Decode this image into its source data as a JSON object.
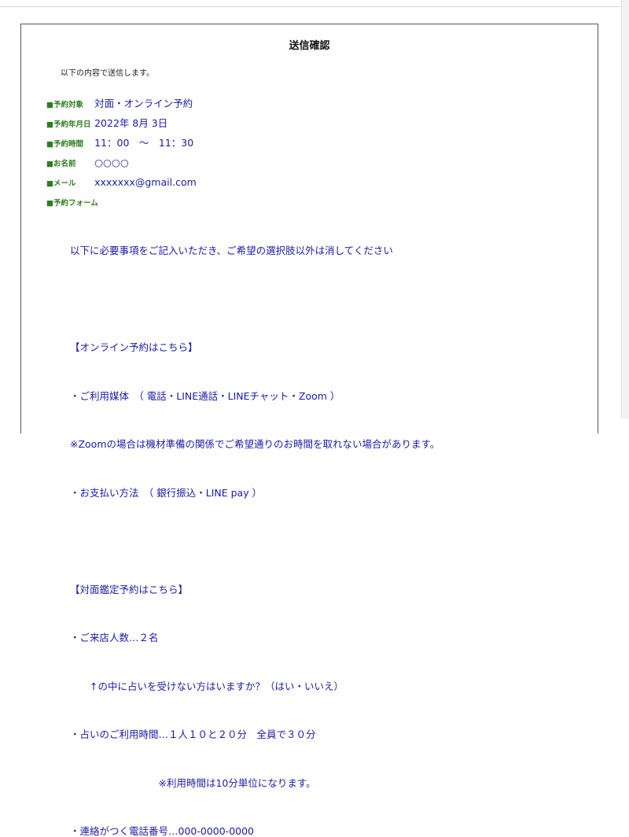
{
  "page": {
    "title": "送信確認",
    "intro": "以下の内容で送信します。"
  },
  "fields": [
    {
      "label": "■予約対象",
      "value": "対面・オンライン予約"
    },
    {
      "label": "■予約年月日",
      "value": "2022年 8月 3日"
    },
    {
      "label": "■予約時間",
      "value": "11：00　～　11：30"
    },
    {
      "label": "■お名前",
      "value": "○○○○"
    },
    {
      "label": "■メール",
      "value": "xxxxxxx@gmail.com"
    },
    {
      "label": "■予約フォーム",
      "value": ""
    }
  ],
  "form_body": [
    "以下に必要事項をご記入いただき、ご希望の選択肢以外は消してください",
    "",
    "【オンライン予約はこちら】",
    "・ご利用媒体　（ 電話・LINE通話・LINEチャット・Zoom ）",
    "※Zoomの場合は機材準備の関係でご希望通りのお時間を取れない場合があります。",
    "・お支払い方法　（ 銀行振込・LINE pay ）",
    "",
    "【対面鑑定予約はこちら】",
    "・ご来店人数…２名",
    "　　↑の中に占いを受けない方はいますか？（はい・いいえ）",
    "・占いのご利用時間…１人１０と２０分　全員で３０分",
    "　　　　　　　　　※利用時間は10分単位になります。",
    "・連絡がつく電話番号…000-0000-0000"
  ]
}
